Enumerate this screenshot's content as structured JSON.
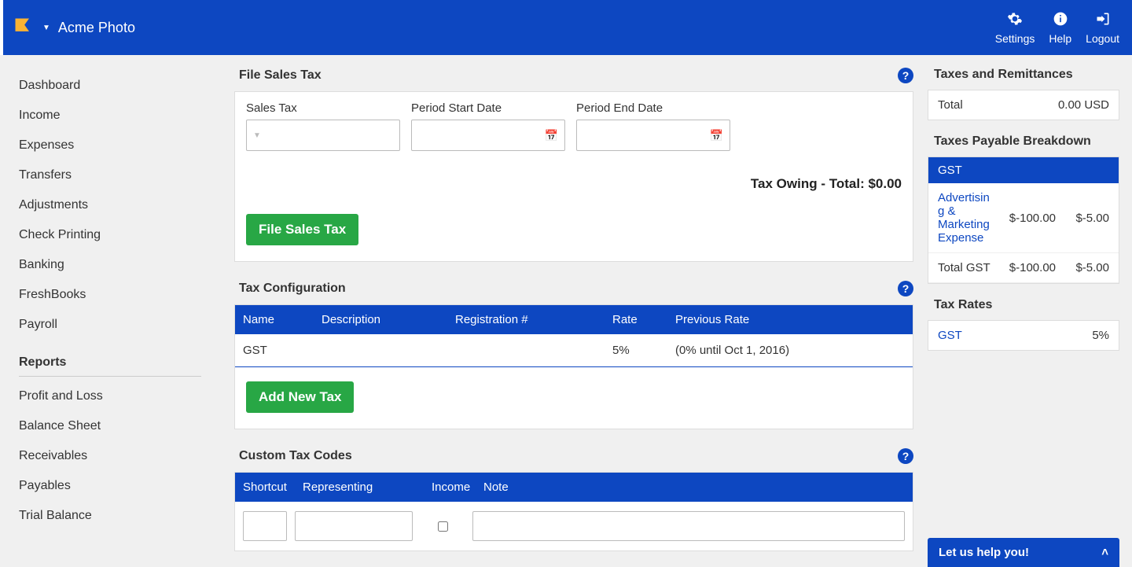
{
  "header": {
    "company": "Acme Photo",
    "actions": {
      "settings": "Settings",
      "help": "Help",
      "logout": "Logout"
    }
  },
  "sidebar": {
    "main": [
      "Dashboard",
      "Income",
      "Expenses",
      "Transfers",
      "Adjustments",
      "Check Printing",
      "Banking",
      "FreshBooks",
      "Payroll"
    ],
    "reportsHeading": "Reports",
    "reports": [
      "Profit and Loss",
      "Balance Sheet",
      "Receivables",
      "Payables",
      "Trial Balance"
    ]
  },
  "fileSalesTax": {
    "title": "File Sales Tax",
    "fields": {
      "salesTax": "Sales Tax",
      "periodStart": "Period Start Date",
      "periodEnd": "Period End Date"
    },
    "taxOwing": "Tax Owing - Total: $0.00",
    "button": "File Sales Tax"
  },
  "taxConfig": {
    "title": "Tax Configuration",
    "headers": {
      "name": "Name",
      "description": "Description",
      "registration": "Registration #",
      "rate": "Rate",
      "previousRate": "Previous Rate"
    },
    "rows": [
      {
        "name": "GST",
        "description": "",
        "registration": "",
        "rate": "5%",
        "previousRate": "(0% until Oct 1, 2016)"
      }
    ],
    "button": "Add New Tax"
  },
  "customTaxCodes": {
    "title": "Custom Tax Codes",
    "headers": {
      "shortcut": "Shortcut",
      "representing": "Representing",
      "income": "Income",
      "note": "Note"
    }
  },
  "right": {
    "taxesRemit": {
      "title": "Taxes and Remittances",
      "totalLabel": "Total",
      "totalValue": "0.00 USD"
    },
    "payableBreakdown": {
      "title": "Taxes Payable Breakdown",
      "group": "GST",
      "rows": [
        {
          "label": "Advertising & Marketing Expense",
          "v1": "$-100.00",
          "v2": "$-5.00",
          "link": true
        },
        {
          "label": "Total GST",
          "v1": "$-100.00",
          "v2": "$-5.00",
          "link": false
        }
      ]
    },
    "taxRates": {
      "title": "Tax Rates",
      "rows": [
        {
          "label": "GST",
          "value": "5%"
        }
      ]
    }
  },
  "helpBar": "Let us help you!"
}
